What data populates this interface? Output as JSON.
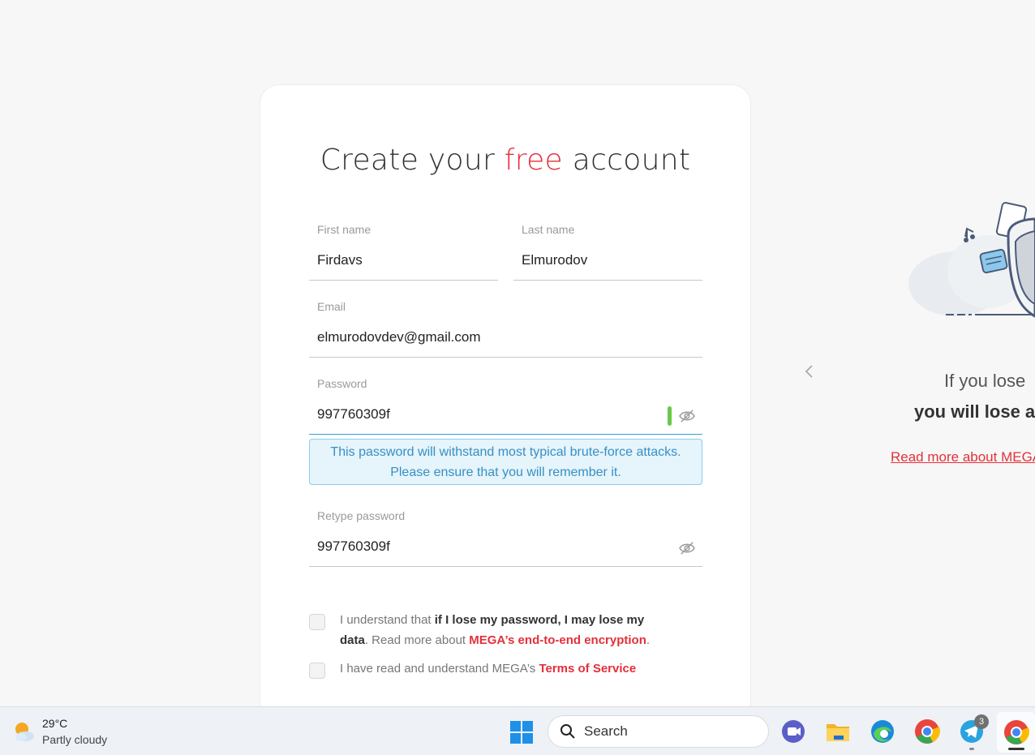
{
  "form": {
    "title_pre": "Create your ",
    "title_accent": "free",
    "title_post": " account",
    "first_name": {
      "label": "First name",
      "value": "Firdavs"
    },
    "last_name": {
      "label": "Last name",
      "value": "Elmurodov"
    },
    "email": {
      "label": "Email",
      "value": "elmurodovdev@gmail.com"
    },
    "password": {
      "label": "Password",
      "value": "997760309f"
    },
    "password_hint_line1": "This password will withstand most typical brute-force attacks.",
    "password_hint_line2": "Please ensure that you will remember it.",
    "retype_password": {
      "label": "Retype password",
      "value": "997760309f"
    },
    "check1": {
      "pre": "I understand that ",
      "bold": "if I lose my password, I may lose my data",
      "mid": ". Read more about ",
      "link": "MEGA’s end-to-end encryption",
      "post": "."
    },
    "check2": {
      "pre": "I have read and understand MEGA’s ",
      "link": "Terms of Service"
    }
  },
  "side_panel": {
    "line1": "If you lose",
    "line2": "you will lose a",
    "link": "Read more about MEGA"
  },
  "taskbar": {
    "temperature": "29°C",
    "condition": "Partly cloudy",
    "search_label": "Search",
    "telegram_badge": "3"
  },
  "colors": {
    "accent": "#e3303a",
    "hint": "#3590c4",
    "strength": "#6bc84a"
  }
}
